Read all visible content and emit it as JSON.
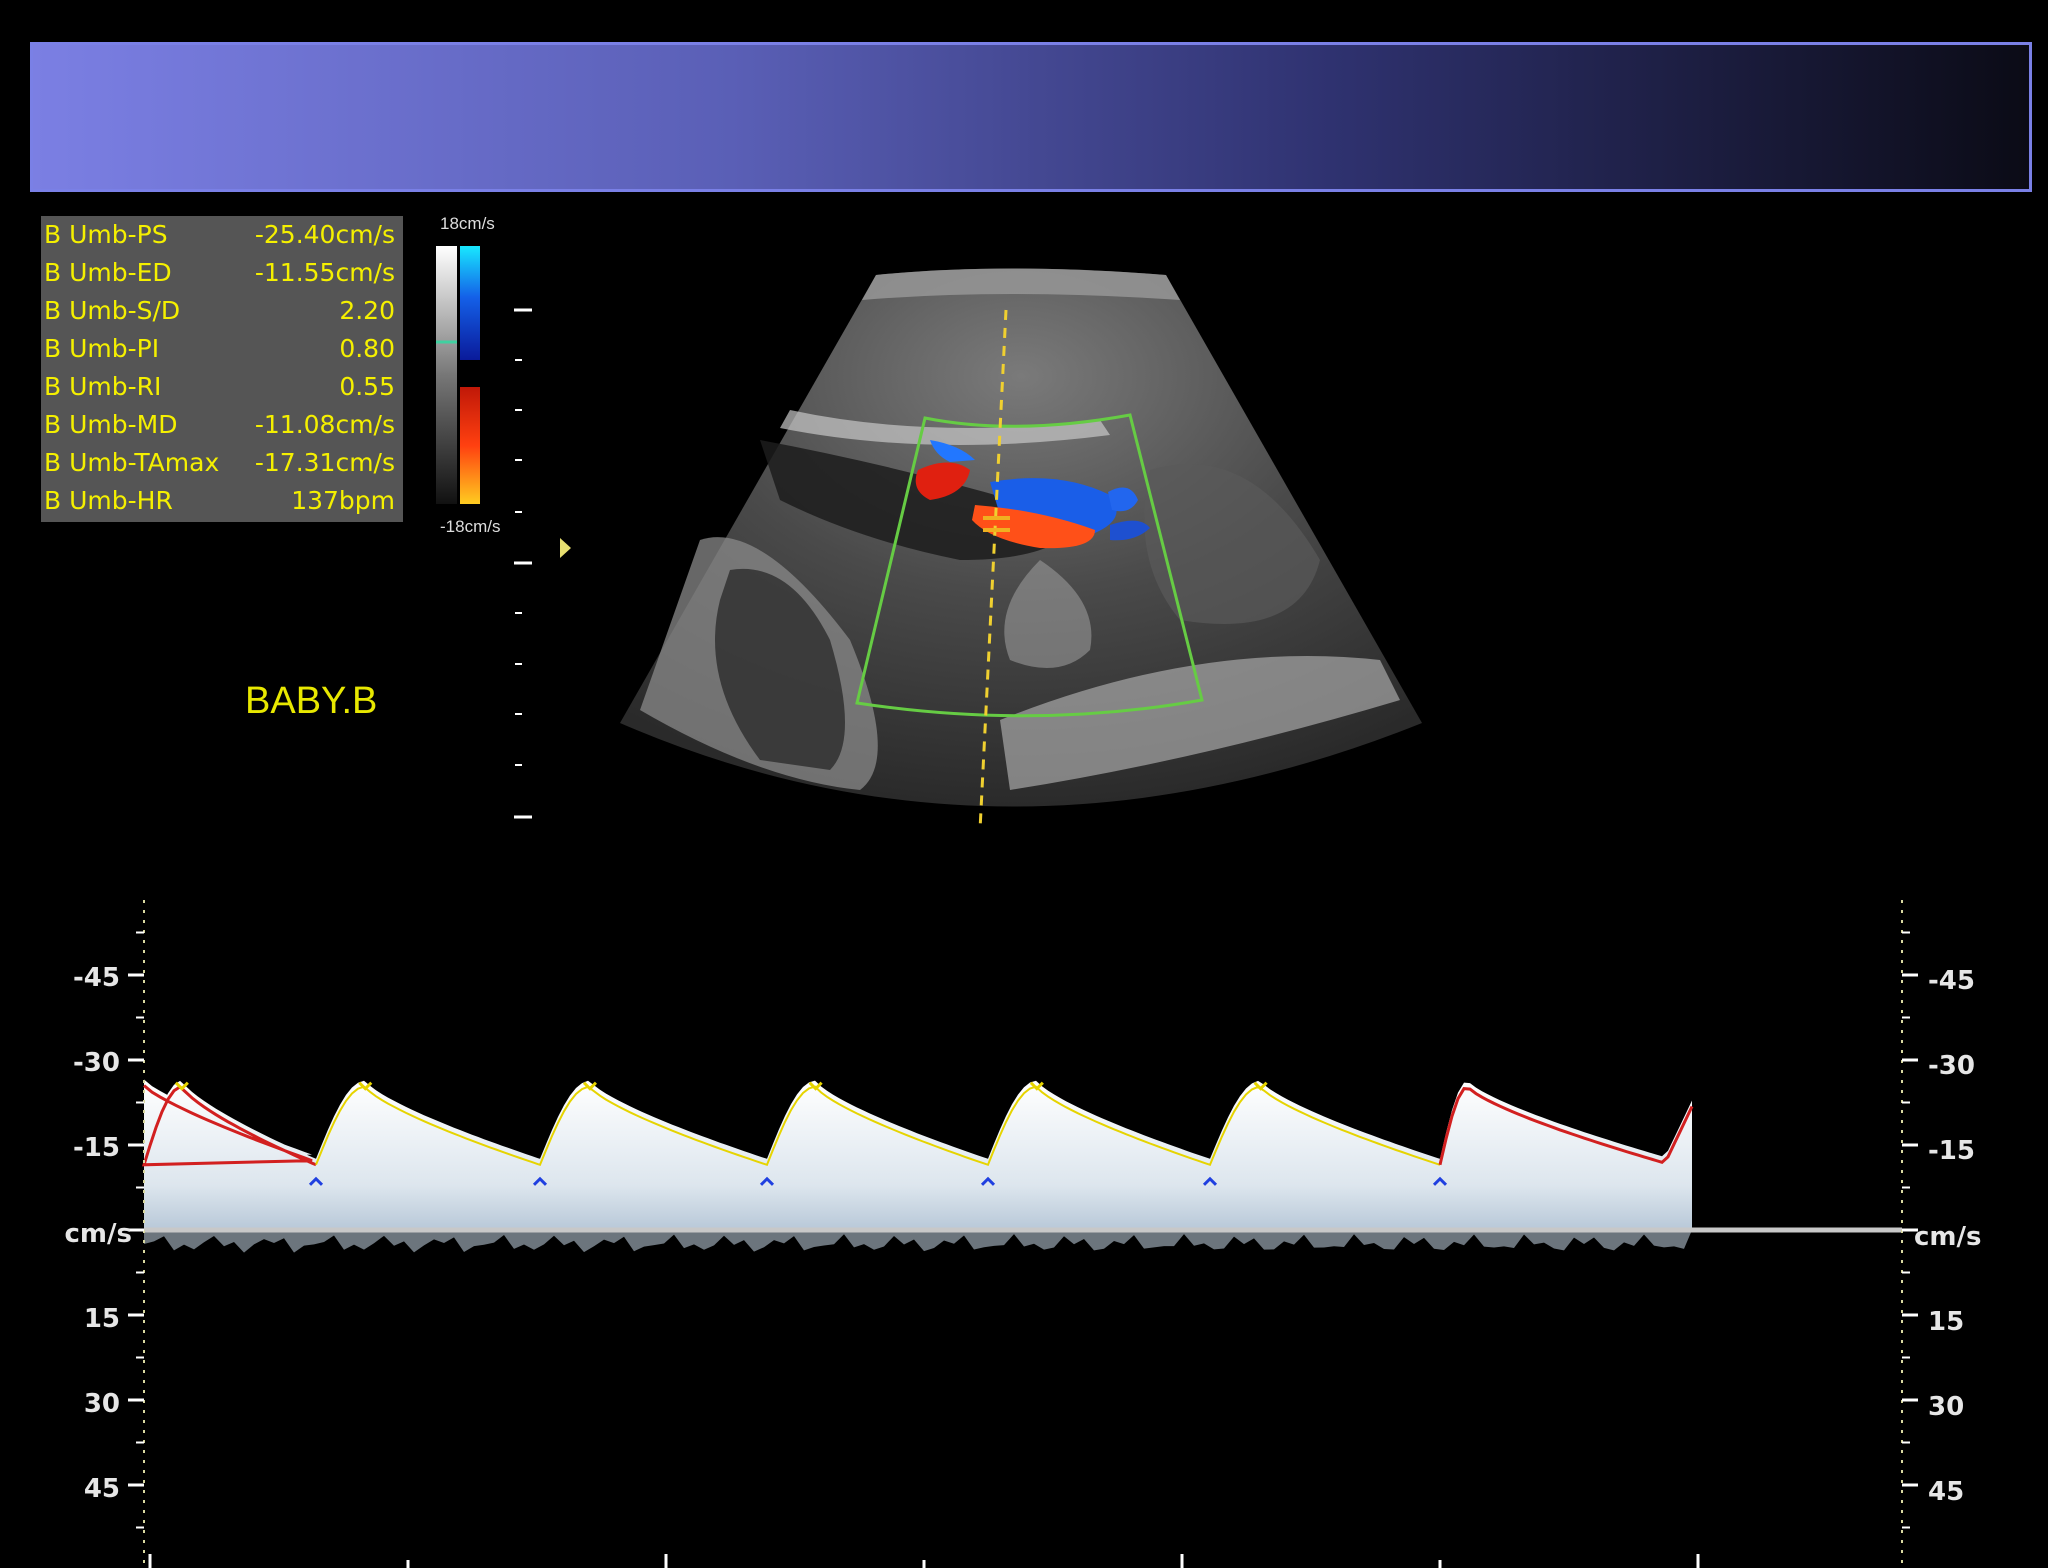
{
  "measurements": [
    {
      "label": "B Umb-PS",
      "value": "-25.40cm/s"
    },
    {
      "label": "B Umb-ED",
      "value": "-11.55cm/s"
    },
    {
      "label": "B Umb-S/D",
      "value": "2.20"
    },
    {
      "label": "B Umb-PI",
      "value": "0.80"
    },
    {
      "label": "B Umb-RI",
      "value": "0.55"
    },
    {
      "label": "B Umb-MD",
      "value": "-11.08cm/s"
    },
    {
      "label": "B Umb-TAmax",
      "value": "-17.31cm/s"
    },
    {
      "label": "B Umb-HR",
      "value": "137bpm"
    }
  ],
  "patient_label": "BABY.B",
  "color_scale": {
    "top": "18cm/s",
    "bottom": "-18cm/s"
  },
  "doppler_axis": {
    "ticks": [
      "-45",
      "-30",
      "-15",
      "cm/s",
      "15",
      "30",
      "45"
    ],
    "unit": "cm/s"
  },
  "colors": {
    "measurement_text": "#f5f000",
    "trace_yellow": "#e6d400",
    "trace_red": "#d22020",
    "roi_box": "#66cc44",
    "header_start": "#7b7fe3",
    "header_end": "#0b0b16"
  }
}
